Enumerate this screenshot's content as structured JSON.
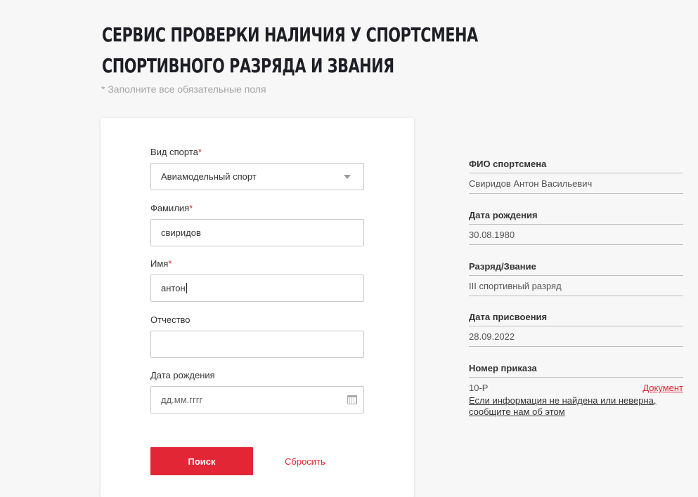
{
  "page": {
    "title_line1": "Сервис проверки наличия у спортсмена",
    "title_line2": "спортивного разряда и звания",
    "hint": "* Заполните все обязательные поля"
  },
  "form": {
    "sport": {
      "label": "Вид спорта",
      "required_mark": "*",
      "value": "Авиамодельный спорт"
    },
    "lastname": {
      "label": "Фамилия",
      "required_mark": "*",
      "value": "свиридов"
    },
    "firstname": {
      "label": "Имя",
      "required_mark": "*",
      "value": "антон"
    },
    "patronymic": {
      "label": "Отчество",
      "value": ""
    },
    "birthdate": {
      "label": "Дата рождения",
      "placeholder": "дд.мм.гггг"
    },
    "search_label": "Поиск",
    "reset_label": "Сбросить"
  },
  "result": {
    "fio": {
      "label": "ФИО спортсмена",
      "value": "Свиридов Антон Васильевич"
    },
    "birthdate": {
      "label": "Дата рождения",
      "value": "30.08.1980"
    },
    "rank": {
      "label": "Разряд/Звание",
      "value": "III спортивный разряд"
    },
    "assigned": {
      "label": "Дата присвоения",
      "value": "28.09.2022"
    },
    "order": {
      "label": "Номер приказа",
      "value": "10-Р",
      "doc_link": "Документ"
    },
    "report_line1": "Если информация не найдена или неверна,",
    "report_line2": "сообщите нам об этом"
  },
  "colors": {
    "accent": "#e32636",
    "background": "#f7f7f7",
    "title": "#1e1e26"
  },
  "icons": [
    "chevron-down-icon",
    "calendar-icon"
  ]
}
